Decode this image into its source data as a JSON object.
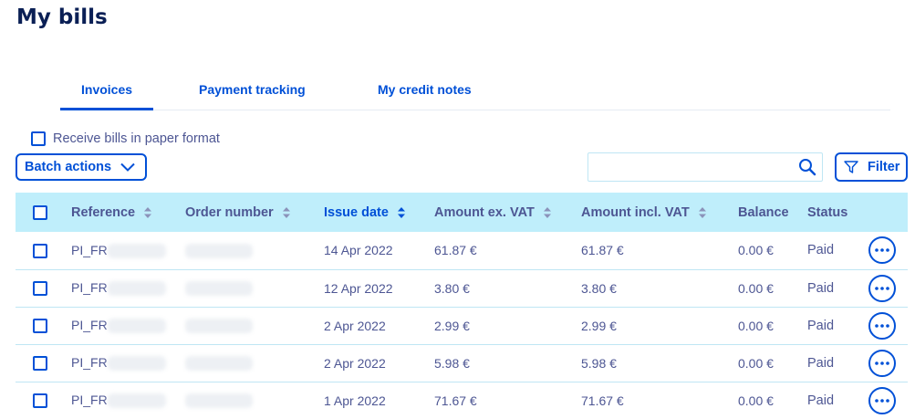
{
  "page": {
    "title": "My bills"
  },
  "tabs": [
    {
      "label": "Invoices",
      "active": true
    },
    {
      "label": "Payment tracking",
      "active": false
    },
    {
      "label": "My credit notes",
      "active": false
    }
  ],
  "paper_format": {
    "label": "Receive bills in paper format",
    "checked": false
  },
  "toolbar": {
    "batch_label": "Batch actions",
    "search_value": "",
    "search_placeholder": "",
    "filter_label": "Filter"
  },
  "table": {
    "columns": [
      "Reference",
      "Order number",
      "Issue date",
      "Amount ex. VAT",
      "Amount incl. VAT",
      "Balance",
      "Status"
    ],
    "sorted_column": "Issue date",
    "rows": [
      {
        "reference": "PI_FR",
        "issue_date": "14 Apr 2022",
        "amount_ex_vat": "61.87 €",
        "amount_incl_vat": "61.87 €",
        "balance": "0.00 €",
        "status": "Paid"
      },
      {
        "reference": "PI_FR",
        "issue_date": "12 Apr 2022",
        "amount_ex_vat": "3.80 €",
        "amount_incl_vat": "3.80 €",
        "balance": "0.00 €",
        "status": "Paid"
      },
      {
        "reference": "PI_FR",
        "issue_date": "2 Apr 2022",
        "amount_ex_vat": "2.99 €",
        "amount_incl_vat": "2.99 €",
        "balance": "0.00 €",
        "status": "Paid"
      },
      {
        "reference": "PI_FR",
        "issue_date": "2 Apr 2022",
        "amount_ex_vat": "5.98 €",
        "amount_incl_vat": "5.98 €",
        "balance": "0.00 €",
        "status": "Paid"
      },
      {
        "reference": "PI_FR",
        "issue_date": "1 Apr 2022",
        "amount_ex_vat": "71.67 €",
        "amount_incl_vat": "71.67 €",
        "balance": "0.00 €",
        "status": "Paid"
      }
    ]
  },
  "icons": {
    "batch": "chevron-down-icon",
    "search": "search-icon",
    "filter": "filter-icon",
    "sort": "sort-icon",
    "row_menu": "more-options-icon"
  },
  "colors": {
    "accent": "#0050d7",
    "title": "#0a1f55",
    "text": "#4d5693",
    "header_bg": "#bfeefb",
    "row_border": "#bfe6f4"
  }
}
